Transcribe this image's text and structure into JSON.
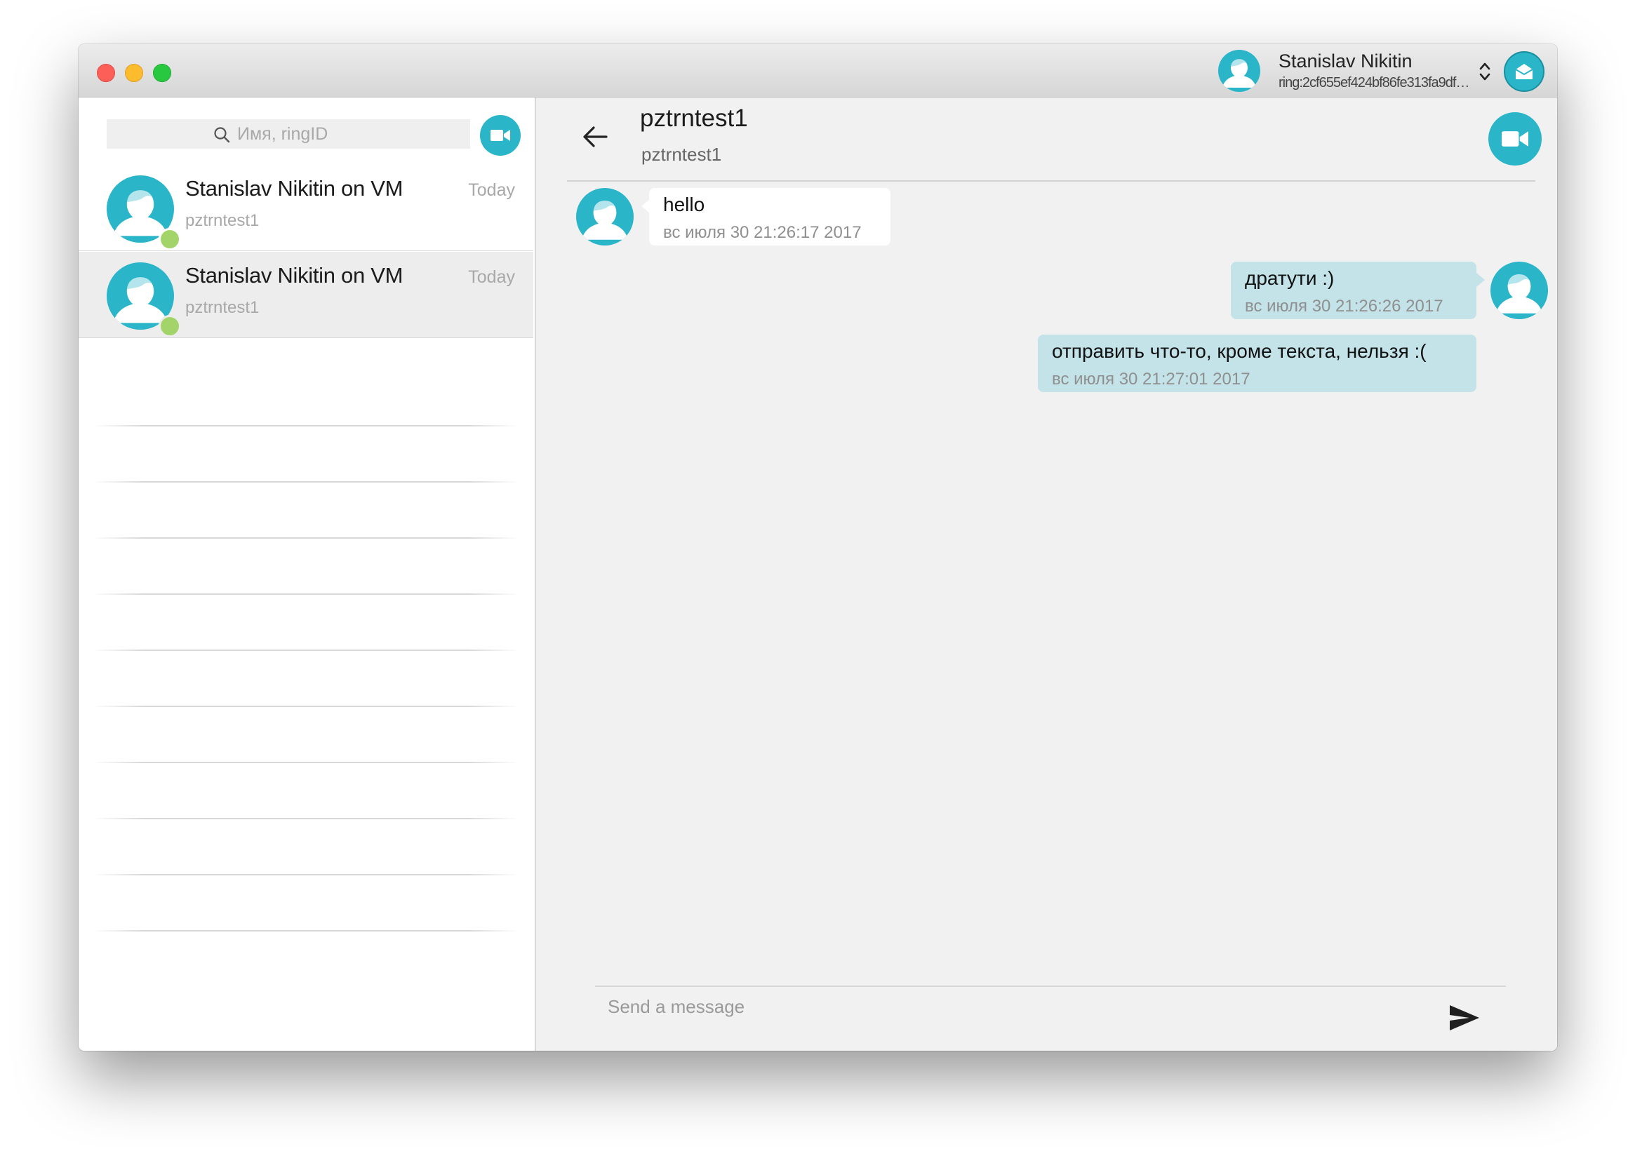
{
  "window": {
    "controls": [
      "close",
      "minimize",
      "zoom"
    ]
  },
  "account": {
    "name": "Stanislav Nikitin",
    "ring_id": "ring:2cf655ef424bf86fe313fa9df…",
    "avatar_icon": "person-icon",
    "switcher_icon": "chevron-updown-icon",
    "inbox_icon": "envelope-icon"
  },
  "sidebar": {
    "search": {
      "placeholder": "Имя, ringID",
      "value": ""
    },
    "new_call_icon": "video-camera-icon",
    "conversations": [
      {
        "name": "Stanislav Nikitin on VM",
        "subtitle": "pztrntest1",
        "time": "Today",
        "presence": "online",
        "selected": false
      },
      {
        "name": "Stanislav Nikitin on VM",
        "subtitle": "pztrntest1",
        "time": "Today",
        "presence": "online",
        "selected": true
      }
    ]
  },
  "chat": {
    "title": "pztrntest1",
    "subtitle": "pztrntest1",
    "back_icon": "arrow-left-icon",
    "video_call_icon": "video-camera-icon",
    "messages": [
      {
        "direction": "incoming",
        "text": "hello",
        "time": "вс июля 30 21:26:17 2017"
      },
      {
        "direction": "outgoing",
        "text": "дратути :)",
        "time": "вс июля 30 21:26:26 2017"
      },
      {
        "direction": "outgoing",
        "text": "отправить что-то, кроме текста, нельзя :(",
        "time": "вс июля 30 21:27:01 2017"
      }
    ],
    "composer": {
      "placeholder": "Send a message",
      "value": "",
      "send_icon": "send-icon"
    }
  },
  "colors": {
    "accent": "#2ab5c9",
    "presence_online": "#a3d469",
    "outgoing_bubble": "#c3e3e9",
    "incoming_bubble": "#ffffff",
    "chat_background": "#f1f1f1",
    "selected_row": "#ededed"
  }
}
